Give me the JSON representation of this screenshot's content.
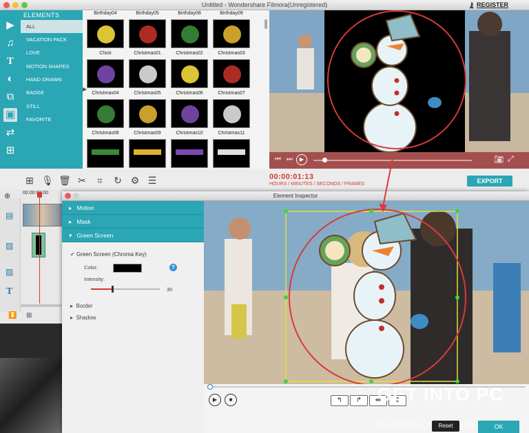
{
  "window_title": "Untitled - Wondershare Filmora(Unregistered)",
  "register": "REGISTER",
  "elements_title": "ELEMENTS",
  "categories": [
    "ALL",
    "VACATION PACK",
    "LOVE",
    "MOTION SHAPES",
    "HAND DRAWN",
    "BADGE",
    "STILL",
    "FAVORITE"
  ],
  "thumb_rows": [
    [
      "Birthday04",
      "Birthday05",
      "Birthday08",
      "Birthday09"
    ],
    [
      "Chick",
      "Christmas01",
      "Christmas02",
      "Christmas03"
    ],
    [
      "Christmas04",
      "Christmas05",
      "Christmas06",
      "Christmas07"
    ],
    [
      "Christmas08",
      "Christmas09",
      "Christmas10",
      "Christmas11"
    ]
  ],
  "timecode": "00:00:01:13",
  "timecode_label": "HOURS / MINUTES / SECONDS / FRAMES",
  "export": "EXPORT",
  "timeline_ruler": "00:00:00:00",
  "inspector_title": "Element Inspector",
  "sections": [
    "Motion",
    "Mask",
    "Green Screen"
  ],
  "green_screen": {
    "checkbox": "Green Screen (Chroma Key)",
    "color_label": "Color:",
    "intensity_label": "Intensity:",
    "intensity_value": "30",
    "intensity": 0.3,
    "key_color": "#000000"
  },
  "extra_sections": [
    "Border",
    "Shadow"
  ],
  "watermark": "GET INTO PC",
  "watermark_sub": "Download Free Your Desired App",
  "reset": "Reset",
  "ok": "OK",
  "colors": {
    "accent": "#2aa6b4",
    "red": "#d03a2e"
  }
}
